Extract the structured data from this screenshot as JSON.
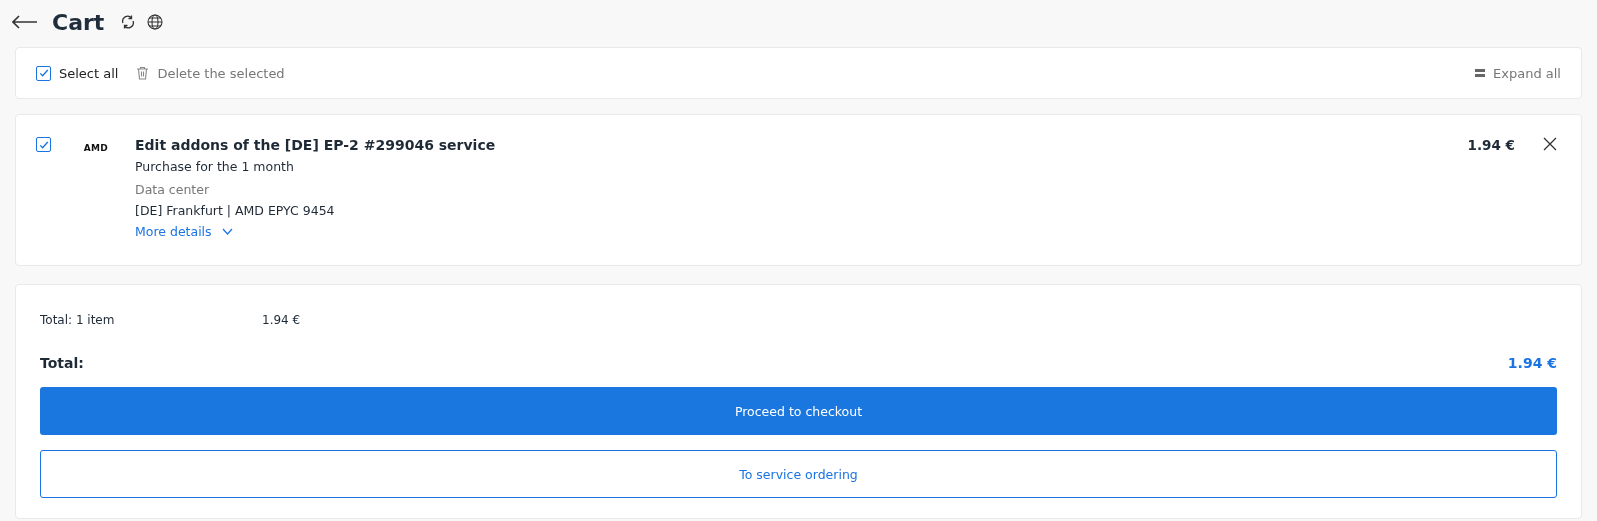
{
  "header": {
    "title": "Cart"
  },
  "toolbar": {
    "select_all": {
      "label": "Select all",
      "checked": true
    },
    "delete_label": "Delete the selected",
    "expand_label": "Expand all"
  },
  "items": [
    {
      "checked": true,
      "logo": "AMD",
      "title": "Edit addons of the [DE] EP-2 #299046 service",
      "period": "Purchase for the 1 month",
      "detail_label": "Data center",
      "detail_value": "[DE] Frankfurt | AMD EPYC 9454",
      "more": "More details",
      "expanded": false,
      "price": "1.94 €"
    }
  ],
  "summary": {
    "count_label": "Total: 1 item",
    "count_value": "1.94 €",
    "total_label": "Total:",
    "total_value": "1.94 €",
    "primary_button": "Proceed to checkout",
    "secondary_button": "To service ordering"
  }
}
